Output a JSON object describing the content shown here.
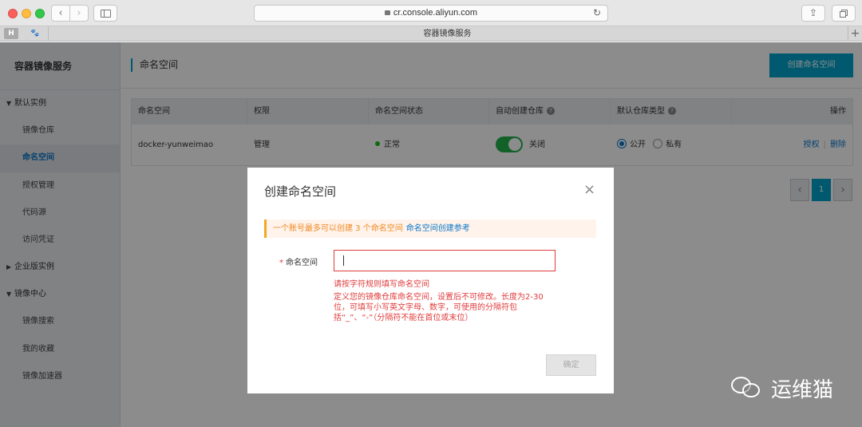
{
  "browser": {
    "url": "cr.console.aliyun.com",
    "tab_title": "容器镜像服务",
    "fav1": "H"
  },
  "sidebar": {
    "title": "容器镜像服务",
    "groups": [
      {
        "label": "默认实例",
        "expanded": true,
        "items": [
          "镜像仓库",
          "命名空间",
          "授权管理",
          "代码源",
          "访问凭证"
        ]
      },
      {
        "label": "企业版实例",
        "expanded": false,
        "items": []
      },
      {
        "label": "镜像中心",
        "expanded": true,
        "items": [
          "镜像搜索",
          "我的收藏",
          "镜像加速器"
        ]
      }
    ],
    "active_item": "命名空间"
  },
  "page": {
    "title": "命名空间",
    "create_button": "创建命名空间"
  },
  "table": {
    "headers": [
      "命名空间",
      "权限",
      "命名空间状态",
      "自动创建仓库",
      "默认仓库类型",
      "操作"
    ],
    "row": {
      "namespace": "docker-yunweimao",
      "permission": "管理",
      "status": "正常",
      "auto_create_label": "关闭",
      "auto_create_on": true,
      "repo_type_public": "公开",
      "repo_type_private": "私有",
      "repo_type_selected": "公开",
      "action_auth": "授权",
      "action_sep": "|",
      "action_delete": "删除"
    }
  },
  "pagination": {
    "prev": "‹",
    "current": "1",
    "next": "›"
  },
  "dialog": {
    "title": "创建命名空间",
    "close": "×",
    "notice": "一个账号最多可以创建 3 个命名空间",
    "notice_link": "命名空间创建参考",
    "field_label": "命名空间",
    "required_mark": "*",
    "input_value": "",
    "error": "请按字符规则填写命名空间",
    "hint": "定义您的镜像仓库命名空间，设置后不可修改。长度为2-30位，可填写小写英文字母、数字，可使用的分隔符包括“_”、“-”（分隔符不能在首位或末位）",
    "confirm_button": "确定"
  },
  "watermark": {
    "text": "运维猫"
  },
  "colors": {
    "accent": "#00a2ca",
    "link": "#0b77c8",
    "error": "#e03b3b",
    "toggle_on": "#21b14c",
    "notice_border": "#f5a623"
  }
}
